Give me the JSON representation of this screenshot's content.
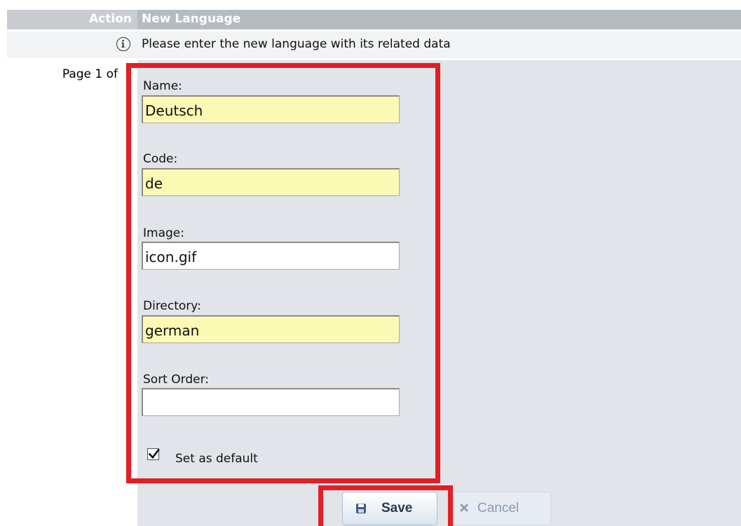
{
  "header": {
    "left_label": "Action",
    "title": "New Language"
  },
  "info": {
    "icon": "info-icon",
    "message": "Please enter the new language with its related data"
  },
  "paging": {
    "label": "Page 1 of"
  },
  "form": {
    "name": {
      "label": "Name:",
      "value": "Deutsch",
      "required": true
    },
    "code": {
      "label": "Code:",
      "value": "de",
      "required": true
    },
    "image": {
      "label": "Image:",
      "value": "icon.gif",
      "required": false
    },
    "directory": {
      "label": "Directory:",
      "value": "german",
      "required": true
    },
    "sort_order": {
      "label": "Sort Order:",
      "value": "",
      "required": false
    },
    "default_checkbox": {
      "label": "Set as default",
      "checked": true
    }
  },
  "buttons": {
    "save_label": "Save",
    "save_icon": "floppy-disk-icon",
    "cancel_label": "Cancel",
    "cancel_icon": "x-icon"
  },
  "colors": {
    "highlight": "#e31e24",
    "required_bg": "#fafab4",
    "panel_bg": "#e1e5e9",
    "header_bg": "#b4bbc3"
  }
}
